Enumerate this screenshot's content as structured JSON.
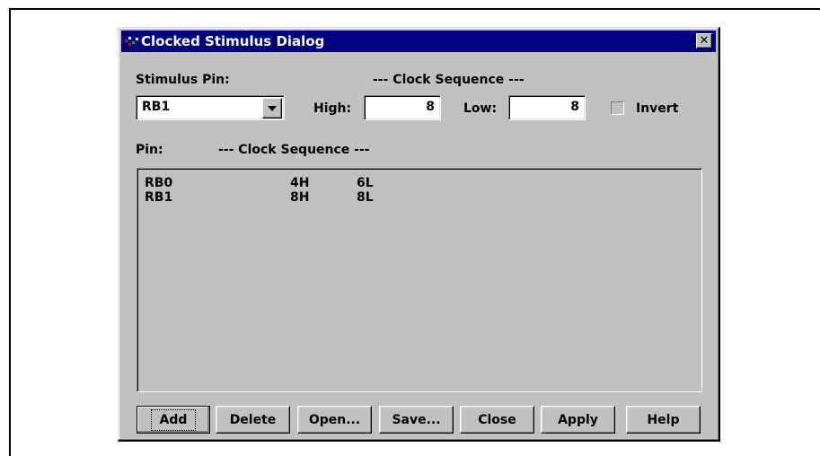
{
  "dialog": {
    "title": "Clocked Stimulus Dialog",
    "close_glyph": "✕"
  },
  "labels": {
    "stimulus_pin": "Stimulus Pin:",
    "clock_sequence_header": "--- Clock Sequence ---",
    "high": "High:",
    "low": "Low:",
    "invert": "Invert",
    "pin_column": "Pin:",
    "list_clock_sequence_column": "--- Clock Sequence ---"
  },
  "inputs": {
    "stimulus_pin_value": "RB1",
    "high_value": "8",
    "low_value": "8",
    "invert_checked": false
  },
  "sequence_list": [
    {
      "pin": "RB0",
      "high": "4H",
      "low": "6L"
    },
    {
      "pin": "RB1",
      "high": "8H",
      "low": "8L"
    }
  ],
  "buttons": {
    "add": "Add",
    "delete": "Delete",
    "open": "Open...",
    "save": "Save...",
    "close": "Close",
    "apply": "Apply",
    "help": "Help"
  },
  "colors": {
    "titlebar": "#000080",
    "face": "#c0c0c0"
  },
  "icons": {
    "title": "app-logo-icon",
    "combo": "dropdown-arrow-icon",
    "close": "close-icon"
  }
}
